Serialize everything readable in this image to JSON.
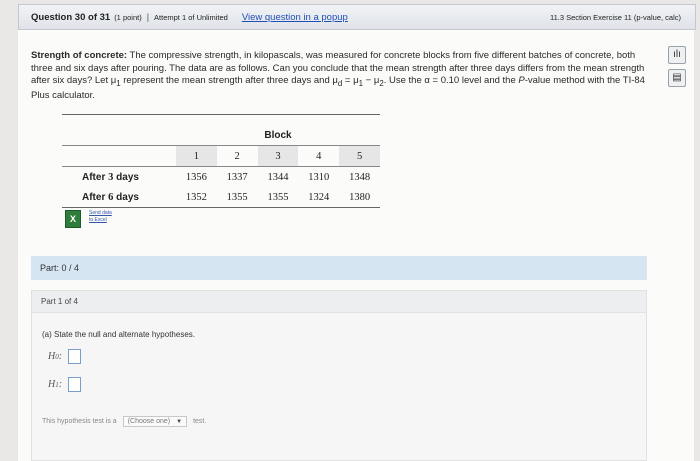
{
  "header": {
    "question": "Question 30 of 31",
    "points": "(1 point)",
    "separator": "|",
    "attempt": "Attempt 1 of Unlimited",
    "popup_link": "View question in a popup",
    "section": "11.3 Section Exercise 11 (p-value, calc)"
  },
  "problem": {
    "title": "Strength of concrete:",
    "text1": " The compressive strength, in kilopascals, was measured for concrete blocks from five different batches of concrete, both three and six days after pouring. The data are as follows. Can you conclude that the mean strength after three days differs from the mean strength after six days? Let ",
    "mu1": "μ",
    "sub1": "1",
    "text2": " represent the mean strength after three days and ",
    "mud": "μ",
    "subd": "d",
    "eq": " = ",
    "mu_a": "μ",
    "sub_a": "1",
    "minus": " − ",
    "mu_b": "μ",
    "sub_b": "2",
    "text3": ". Use the ",
    "alpha": "α",
    "alpha_val": " = 0.10",
    "text4": " level and the ",
    "pval": "P",
    "text5": "-value method with the TI-84 Plus calculator."
  },
  "icons": {
    "top": "bar-chart-icon",
    "bottom": "calculator-icon",
    "top_glyph": "ılı",
    "bottom_glyph": "▤"
  },
  "table": {
    "header": "Block",
    "columns": [
      "1",
      "2",
      "3",
      "4",
      "5"
    ],
    "rows": [
      {
        "label_pre": "After ",
        "label_num": "3",
        "label_post": " days",
        "values": [
          "1356",
          "1337",
          "1344",
          "1310",
          "1348"
        ]
      },
      {
        "label_pre": "After ",
        "label_num": "6",
        "label_post": " days",
        "values": [
          "1352",
          "1355",
          "1355",
          "1324",
          "1380"
        ]
      }
    ]
  },
  "excel": {
    "glyph": "X",
    "line1": "Send data",
    "line2": "to Excel"
  },
  "part": {
    "progress": "Part: 0 / 4",
    "sub": "Part 1 of 4",
    "prompt": "(a) State the null and alternate hypotheses.",
    "h0": "H",
    "h0_sub": "0",
    "h1": "H",
    "h1_sub": "1",
    "colon": ":",
    "test_pre": "This hypothesis test is a",
    "choose": "(Choose one)",
    "arrow": "▼",
    "test_post": "test."
  }
}
